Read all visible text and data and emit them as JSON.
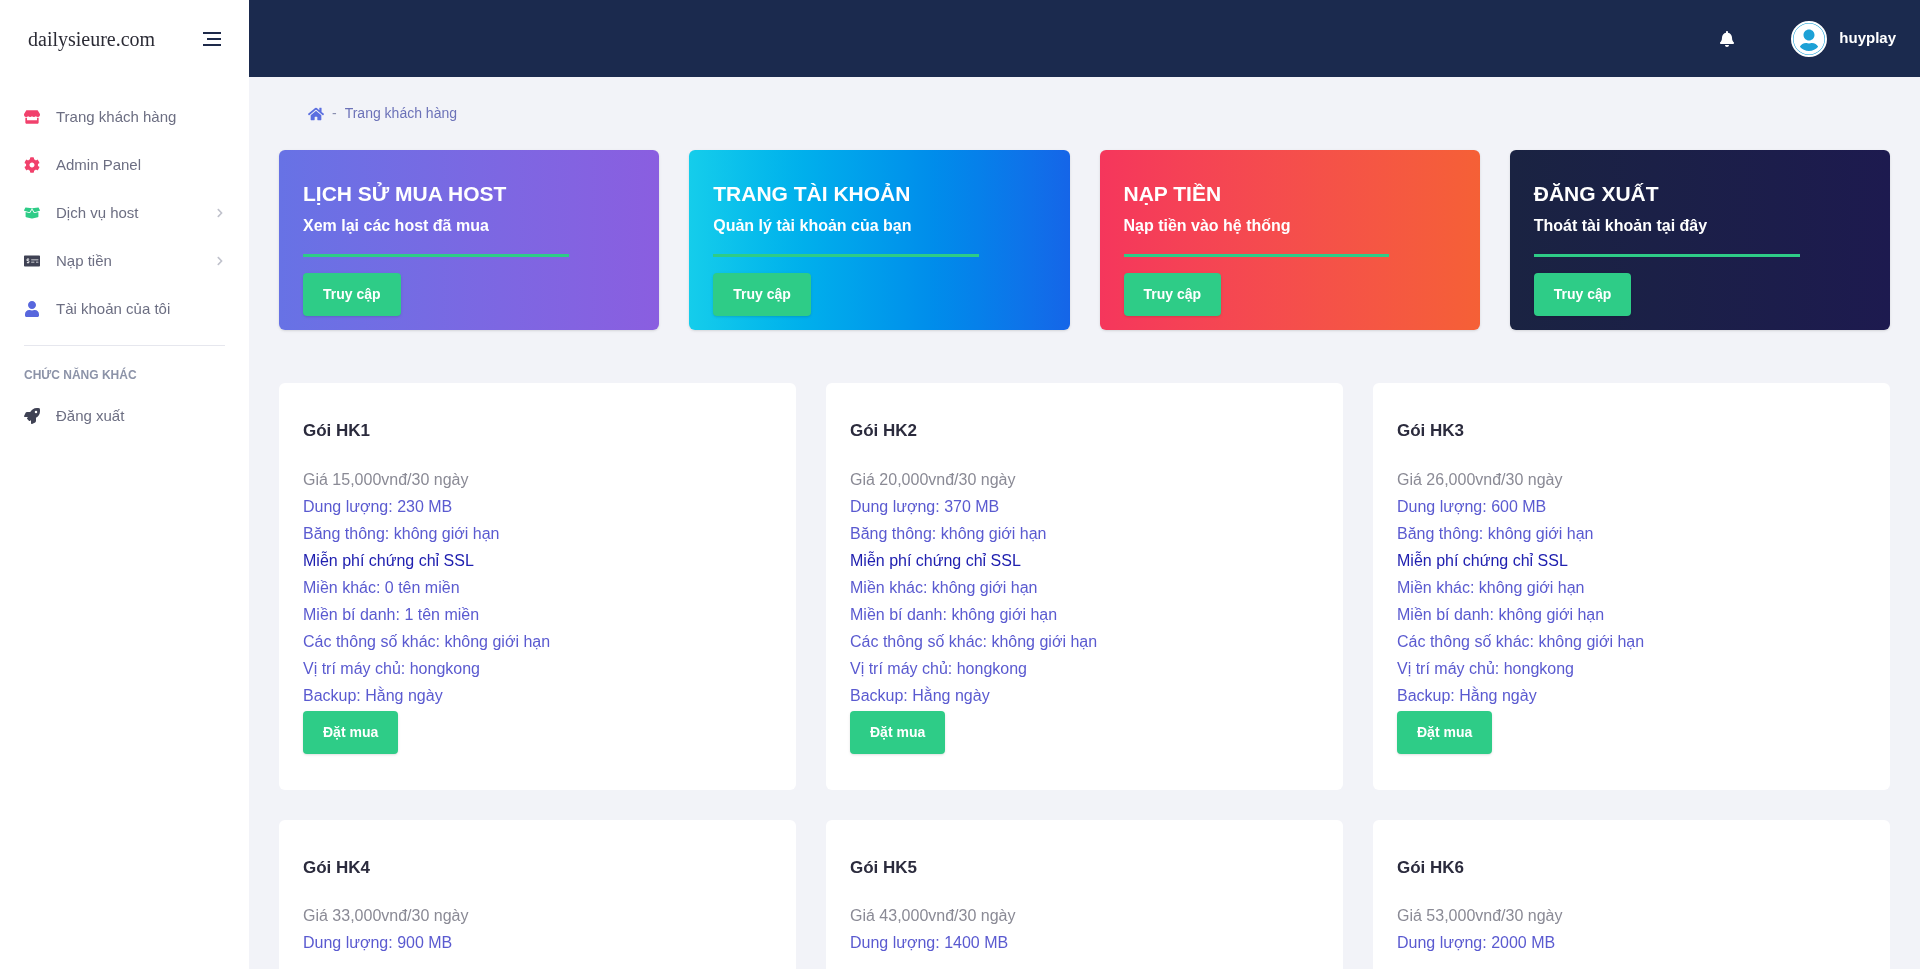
{
  "sidebar": {
    "logo": "dailysieure.com",
    "items": [
      {
        "label": "Trang khách hàng",
        "kind": "store",
        "has_submenu": false
      },
      {
        "label": "Admin Panel",
        "kind": "gear",
        "has_submenu": false
      },
      {
        "label": "Dịch vụ host",
        "kind": "box",
        "has_submenu": true
      },
      {
        "label": "Nạp tiền",
        "kind": "money",
        "has_submenu": true
      },
      {
        "label": "Tài khoản của tôi",
        "kind": "user",
        "has_submenu": false
      }
    ],
    "section_title": "CHỨC NĂNG KHÁC",
    "section_items": [
      {
        "label": "Đăng xuất",
        "kind": "rocket",
        "has_submenu": false
      }
    ]
  },
  "header": {
    "username": "huyplay"
  },
  "breadcrumb": {
    "separator": "-",
    "label": "Trang khách hàng"
  },
  "action_cards": [
    {
      "kind": "violet",
      "title": "LỊCH SỬ MUA HOST",
      "subtitle": "Xem lại các host đã mua",
      "button": "Truy cập"
    },
    {
      "kind": "blue",
      "title": "TRANG TÀI KHOẢN",
      "subtitle": "Quản lý tài khoản của bạn",
      "button": "Truy cập"
    },
    {
      "kind": "red",
      "title": "NẠP TIỀN",
      "subtitle": "Nạp tiền vào hệ thống",
      "button": "Truy cập"
    },
    {
      "kind": "navy",
      "title": "ĐĂNG XUẤT",
      "subtitle": "Thoát tài khoản tại đây",
      "button": "Truy cập"
    }
  ],
  "packages": [
    {
      "name": "Gói HK1",
      "lines": [
        {
          "kind": "price",
          "text": "Giá 15,000vnđ/30 ngày"
        },
        {
          "kind": "spec",
          "text": "Dung lượng: 230 MB"
        },
        {
          "kind": "spec",
          "text": "Băng thông: không giới hạn"
        },
        {
          "kind": "highlight",
          "text": "Miễn phí chứng chỉ SSL"
        },
        {
          "kind": "spec",
          "text": "Miền khác: 0 tên miền"
        },
        {
          "kind": "spec",
          "text": "Miền bí danh: 1 tên miền"
        },
        {
          "kind": "spec",
          "text": "Các thông số khác: không giới hạn"
        },
        {
          "kind": "spec",
          "text": "Vị trí máy chủ: hongkong"
        },
        {
          "kind": "spec",
          "text": "Backup: Hằng ngày"
        }
      ],
      "button": "Đặt mua"
    },
    {
      "name": "Gói HK2",
      "lines": [
        {
          "kind": "price",
          "text": "Giá 20,000vnđ/30 ngày"
        },
        {
          "kind": "spec",
          "text": "Dung lượng: 370 MB"
        },
        {
          "kind": "spec",
          "text": "Băng thông: không giới hạn"
        },
        {
          "kind": "highlight",
          "text": "Miễn phí chứng chỉ SSL"
        },
        {
          "kind": "spec",
          "text": "Miền khác: không giới hạn"
        },
        {
          "kind": "spec",
          "text": "Miền bí danh: không giới hạn"
        },
        {
          "kind": "spec",
          "text": "Các thông số khác: không giới hạn"
        },
        {
          "kind": "spec",
          "text": "Vị trí máy chủ: hongkong"
        },
        {
          "kind": "spec",
          "text": "Backup: Hằng ngày"
        }
      ],
      "button": "Đặt mua"
    },
    {
      "name": "Gói HK3",
      "lines": [
        {
          "kind": "price",
          "text": "Giá 26,000vnđ/30 ngày"
        },
        {
          "kind": "spec",
          "text": "Dung lượng: 600 MB"
        },
        {
          "kind": "spec",
          "text": "Băng thông: không giới hạn"
        },
        {
          "kind": "highlight",
          "text": "Miễn phí chứng chỉ SSL"
        },
        {
          "kind": "spec",
          "text": "Miền khác: không giới hạn"
        },
        {
          "kind": "spec",
          "text": "Miền bí danh: không giới hạn"
        },
        {
          "kind": "spec",
          "text": "Các thông số khác: không giới hạn"
        },
        {
          "kind": "spec",
          "text": "Vị trí máy chủ: hongkong"
        },
        {
          "kind": "spec",
          "text": "Backup: Hằng ngày"
        }
      ],
      "button": "Đặt mua"
    },
    {
      "name": "Gói HK4",
      "lines": [
        {
          "kind": "price",
          "text": "Giá 33,000vnđ/30 ngày"
        },
        {
          "kind": "spec",
          "text": "Dung lượng: 900 MB"
        }
      ]
    },
    {
      "name": "Gói HK5",
      "lines": [
        {
          "kind": "price",
          "text": "Giá 43,000vnđ/30 ngày"
        },
        {
          "kind": "spec",
          "text": "Dung lượng: 1400 MB"
        }
      ]
    },
    {
      "name": "Gói HK6",
      "lines": [
        {
          "kind": "price",
          "text": "Giá 53,000vnđ/30 ngày"
        },
        {
          "kind": "spec",
          "text": "Dung lượng: 2000 MB"
        }
      ]
    }
  ]
}
